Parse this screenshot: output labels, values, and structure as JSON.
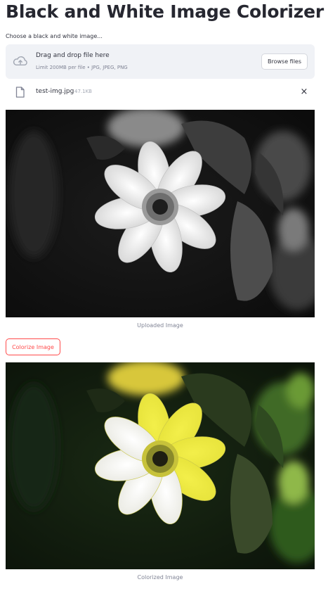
{
  "app": {
    "title": "Black and White Image Colorizer"
  },
  "uploader": {
    "label": "Choose a black and white image...",
    "drop_title": "Drag and drop file here",
    "limit_text": "Limit 200MB per file • JPG, JPEG, PNG",
    "browse_label": "Browse files",
    "cloud_icon": "cloud-upload-icon"
  },
  "uploaded_file": {
    "name": "test-img.jpg",
    "size": "47.1KB",
    "file_icon": "file-icon",
    "remove_icon": "close-icon",
    "remove_glyph": "×"
  },
  "images": {
    "uploaded_caption": "Uploaded Image",
    "colorized_caption": "Colorized Image"
  },
  "actions": {
    "colorize_label": "Colorize Image"
  },
  "colors": {
    "accent": "#ff4b4b",
    "dropzone_bg": "#f0f2f6",
    "text": "#31333f",
    "muted": "#808495"
  }
}
